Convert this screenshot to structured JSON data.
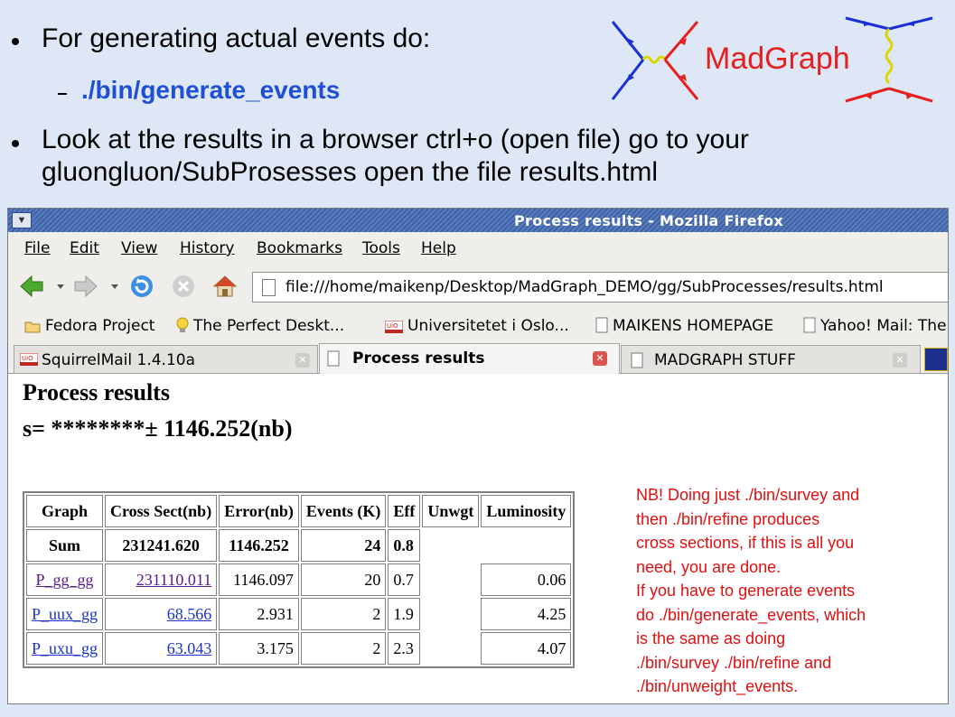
{
  "slide": {
    "bullet1": "For generating actual events do:",
    "sub1": "./bin/generate_events",
    "bullet2_line1": "Look at the results in a browser ctrl+o (open file) go to your",
    "bullet2_line2": "gluongluon/SubProsesses open the file results.html",
    "logo_text": "MadGraph",
    "note": [
      "NB! Doing just ./bin/survey and",
      "then ./bin/refine produces",
      "cross sections, if this is all you",
      "need, you are done.",
      "If you have to generate events",
      "do ./bin/generate_events, which",
      "is the same as doing",
      "./bin/survey ./bin/refine and",
      "./bin/unweight_events."
    ]
  },
  "browser": {
    "window_title": "Process results - Mozilla Firefox",
    "menu": [
      "File",
      "Edit",
      "View",
      "History",
      "Bookmarks",
      "Tools",
      "Help"
    ],
    "url": "file:///home/maikenp/Desktop/MadGraph_DEMO/gg/SubProcesses/results.html",
    "bookmarks": [
      "Fedora Project",
      "The Perfect Deskt...",
      "Universitetet i Oslo...",
      "MAIKENS HOMEPAGE",
      "Yahoo! Mail: The"
    ],
    "tabs": [
      "SquirrelMail 1.4.10a",
      "Process results",
      "MADGRAPH STUFF"
    ],
    "page": {
      "title": "Process results",
      "s_line": "s= ********± 1146.252(nb)",
      "headers": [
        "Graph",
        "Cross Sect(nb)",
        "Error(nb)",
        "Events (K)",
        "Eff",
        "Unwgt",
        "Luminosity"
      ],
      "sum_row": [
        "Sum",
        "231241.620",
        "1146.252",
        "24",
        "0.8"
      ],
      "rows": [
        [
          "P_gg_gg",
          "231110.011",
          "1146.097",
          "20",
          "0.7",
          "",
          "0.06"
        ],
        [
          "P_uux_gg",
          "68.566",
          "2.931",
          "2",
          "1.9",
          "",
          "4.25"
        ],
        [
          "P_uxu_gg",
          "63.043",
          "3.175",
          "2",
          "2.3",
          "",
          "4.07"
        ]
      ]
    }
  },
  "colors": {
    "accent": "#1f4fd6",
    "note": "#e01010",
    "titlebar": "#3f62a5"
  }
}
